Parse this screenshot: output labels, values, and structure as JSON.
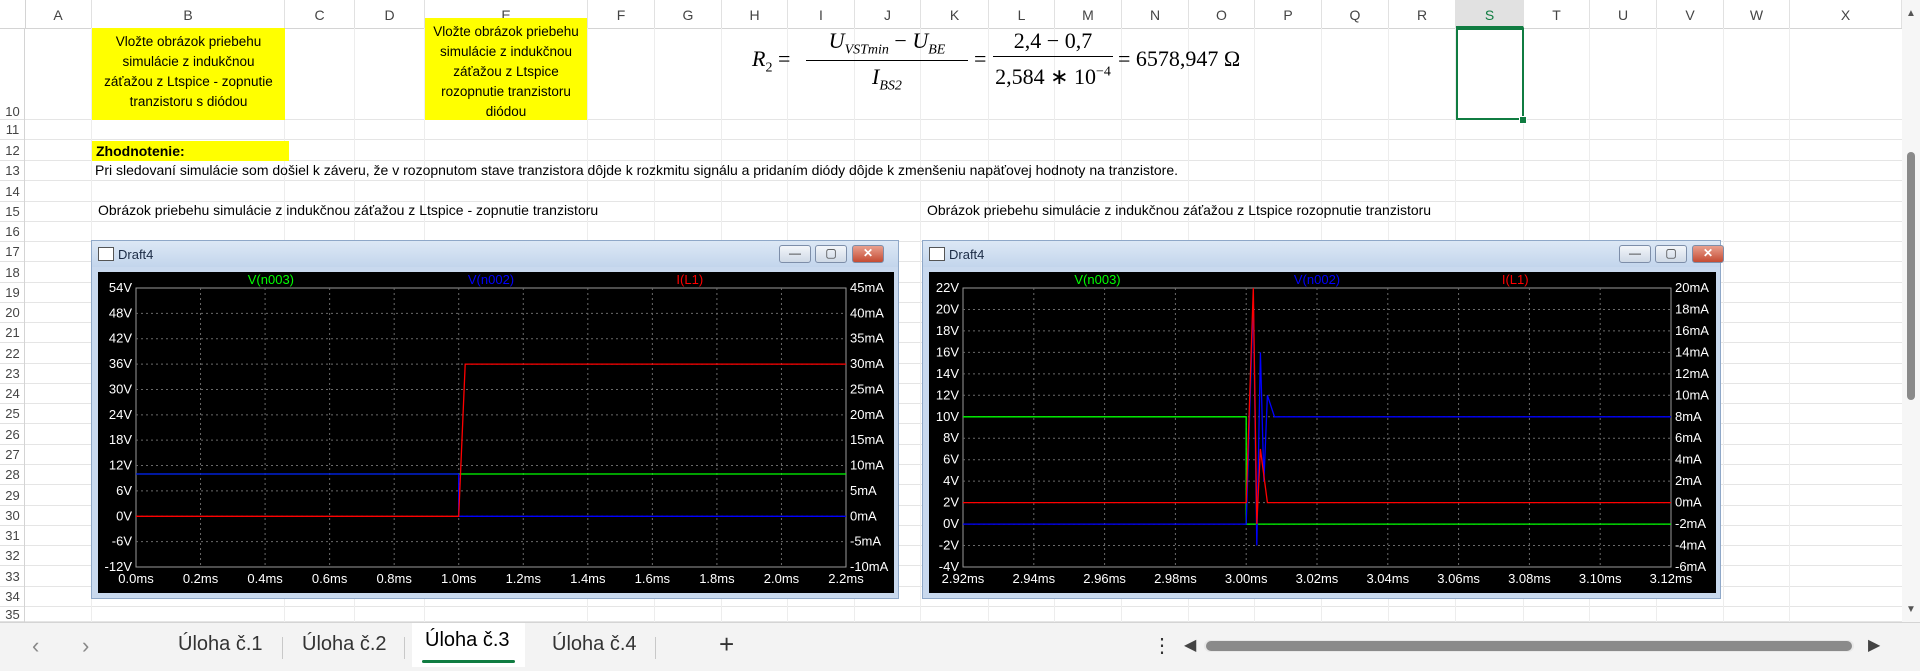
{
  "columns": [
    "A",
    "B",
    "C",
    "D",
    "E",
    "F",
    "G",
    "H",
    "I",
    "J",
    "K",
    "L",
    "M",
    "N",
    "O",
    "P",
    "Q",
    "R",
    "S",
    "T",
    "U",
    "V",
    "W",
    "X"
  ],
  "selected_column": "S",
  "rows": [
    "10",
    "11",
    "12",
    "13",
    "14",
    "15",
    "16",
    "17",
    "18",
    "19",
    "20",
    "21",
    "22",
    "23",
    "24",
    "25",
    "26",
    "27",
    "28",
    "29",
    "30",
    "31",
    "32",
    "33",
    "34",
    "35"
  ],
  "cells": {
    "b_insert": "Vložte obrázok priebehu simulácie z indukčnou záťažou z Ltspice - zopnutie tranzistoru s diódou",
    "e_insert": "Vložte obrázok priebehu simulácie z indukčnou záťažou z Ltspice rozopnutie tranzistoru diódou",
    "formula": "R₂ = (U_VSTmin − U_BE) / I_BS2 = (2,4 − 0,7) / (2,584 ∗ 10⁻⁴) = 6578,947 Ω",
    "evaluation_label": "Zhodnotenie:",
    "evaluation_text": "Pri sledovaní simulácie som došiel k záveru, že v rozopnutom stave tranzistora dôjde k rozkmitu signálu a pridaním diódy dôjde k zmenšeniu napäťovej hodnoty na tranzistore.",
    "caption_left": "Obrázok priebehu simulácie z indukčnou záťažou z Ltspice - zopnutie tranzistoru",
    "caption_right": "Obrázok priebehu simulácie z indukčnou záťažou z Ltspice rozopnutie tranzistoru"
  },
  "formula_parts": {
    "lhs": "R",
    "lhs_sub": "2",
    "num1": "U",
    "num1_sub": "VSTmin",
    "minus": " − ",
    "num2": "U",
    "num2_sub": "BE",
    "den1": "I",
    "den1_sub": "BS2",
    "num_b": "2,4 − 0,7",
    "den_b": "2,584 ∗ 10",
    "den_b_exp": "−4",
    "eq": "=",
    "result": "= 6578,947 Ω"
  },
  "chart_left": {
    "window_title": "Draft4",
    "legend": [
      "V(n003)",
      "V(n002)",
      "I(L1)"
    ],
    "legend_colors": [
      "#00ff00",
      "#0000ff",
      "#ff0000"
    ],
    "y_left_ticks": [
      "54V",
      "48V",
      "42V",
      "36V",
      "30V",
      "24V",
      "18V",
      "12V",
      "6V",
      "0V",
      "-6V",
      "-12V"
    ],
    "y_right_ticks": [
      "45mA",
      "40mA",
      "35mA",
      "30mA",
      "25mA",
      "20mA",
      "15mA",
      "10mA",
      "5mA",
      "0mA",
      "-5mA",
      "-10mA"
    ],
    "x_ticks": [
      "0.0ms",
      "0.2ms",
      "0.4ms",
      "0.6ms",
      "0.8ms",
      "1.0ms",
      "1.2ms",
      "1.4ms",
      "1.6ms",
      "1.8ms",
      "2.0ms",
      "2.2ms"
    ]
  },
  "chart_right": {
    "window_title": "Draft4",
    "legend": [
      "V(n003)",
      "V(n002)",
      "I(L1)"
    ],
    "legend_colors": [
      "#00ff00",
      "#0000ff",
      "#ff0000"
    ],
    "y_left_ticks": [
      "22V",
      "20V",
      "18V",
      "16V",
      "14V",
      "12V",
      "10V",
      "8V",
      "6V",
      "4V",
      "2V",
      "0V",
      "-2V",
      "-4V"
    ],
    "y_right_ticks": [
      "20mA",
      "18mA",
      "16mA",
      "14mA",
      "12mA",
      "10mA",
      "8mA",
      "6mA",
      "4mA",
      "2mA",
      "0mA",
      "-2mA",
      "-4mA",
      "-6mA"
    ],
    "x_ticks": [
      "2.92ms",
      "2.94ms",
      "2.96ms",
      "2.98ms",
      "3.00ms",
      "3.02ms",
      "3.04ms",
      "3.06ms",
      "3.08ms",
      "3.10ms",
      "3.12ms"
    ]
  },
  "chart_data": [
    {
      "type": "line",
      "title": "",
      "xlabel": "",
      "ylabel": "",
      "xlim": [
        0.0,
        2.2
      ],
      "ylim": [
        -12,
        54
      ],
      "y2lim": [
        -10,
        45
      ],
      "x_unit": "ms",
      "series": [
        {
          "name": "V(n003)",
          "axis": "left",
          "x": [
            0.0,
            1.0,
            1.0,
            2.2
          ],
          "y": [
            10,
            10,
            10,
            10
          ],
          "note_dashed_until": 1.0
        },
        {
          "name": "V(n002)",
          "axis": "left",
          "x": [
            0.0,
            1.0,
            1.0,
            2.2
          ],
          "y": [
            10,
            10,
            0,
            0
          ]
        },
        {
          "name": "I(L1)",
          "axis": "right",
          "x": [
            0.0,
            1.0,
            1.02,
            2.2
          ],
          "y": [
            0,
            0,
            30,
            30
          ]
        }
      ],
      "grid": true,
      "legend": "top"
    },
    {
      "type": "line",
      "title": "",
      "xlabel": "",
      "ylabel": "",
      "xlim": [
        2.92,
        3.12
      ],
      "ylim": [
        -4,
        22
      ],
      "y2lim": [
        -6,
        20
      ],
      "x_unit": "ms",
      "series": [
        {
          "name": "V(n003)",
          "axis": "left",
          "x": [
            2.92,
            3.0,
            3.0,
            3.12
          ],
          "y": [
            10,
            10,
            0,
            0
          ]
        },
        {
          "name": "V(n002)",
          "axis": "left",
          "x": [
            2.92,
            3.0,
            3.002,
            3.003,
            3.004,
            3.005,
            3.006,
            3.008,
            3.12
          ],
          "y": [
            0,
            0,
            21,
            -2,
            16,
            4,
            12,
            10,
            10
          ]
        },
        {
          "name": "I(L1)",
          "axis": "right",
          "x": [
            2.92,
            3.0,
            3.002,
            3.003,
            3.004,
            3.006,
            3.12
          ],
          "y": [
            0,
            0,
            20,
            -2,
            5,
            0,
            0
          ]
        }
      ],
      "grid": true,
      "legend": "top"
    }
  ],
  "tabs": [
    "Úloha č.1",
    "Úloha č.2",
    "Úloha č.3",
    "Úloha č.4"
  ],
  "active_tab": "Úloha č.3",
  "add_sheet": "+",
  "more": "⋮"
}
